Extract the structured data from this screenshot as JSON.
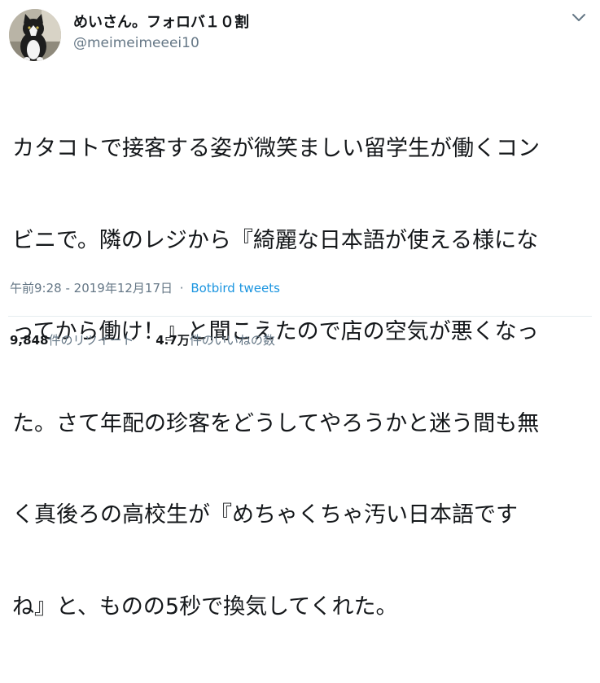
{
  "tweet": {
    "user": {
      "display_name": "めいさん。フォロバ１０割",
      "handle": "@meimeimeeei10"
    },
    "more_icon": "chevron-down-icon",
    "avatar_icon": "cat-photo",
    "text_lines": [
      "カタコトで接客する姿が微笑ましい留学生が働くコン",
      "ビニで。隣のレジから『綺麗な日本語が使える様にな",
      "ってから働け！』と聞こえたので店の空気が悪くなっ",
      "た。さて年配の珍客をどうしてやろうかと迷う間も無",
      "く真後ろの高校生が『めちゃくちゃ汚い日本語です",
      "ね』と、ものの5秒で換気してくれた。"
    ],
    "time": "午前9:28",
    "date": "2019年12月17日",
    "separator": "·",
    "source": "Botbird tweets",
    "retweets": {
      "count": "9,848",
      "label": "件のリツイート"
    },
    "likes": {
      "count": "4.7万",
      "label": "件のいいねの数"
    },
    "colors": {
      "text": "#14171a",
      "secondary": "#657786",
      "link": "#1b95e0",
      "divider": "#e6ecf0"
    }
  }
}
